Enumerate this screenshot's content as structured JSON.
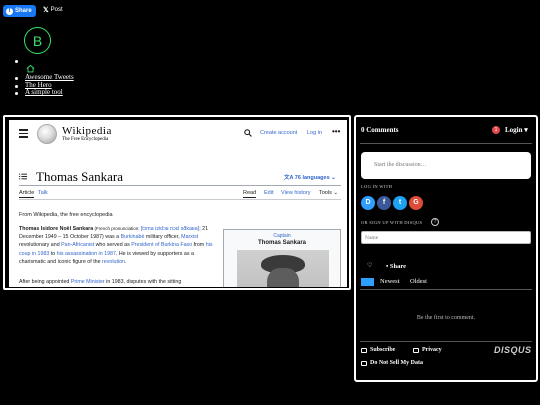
{
  "share_bar": {
    "facebook_label": "Share",
    "x_label": "Post"
  },
  "site": {
    "logo_letter": "B",
    "nav": [
      "Awesome Tweets",
      "The Hero",
      "A simple tool"
    ]
  },
  "wikipedia": {
    "wordmark": "Wikipedia",
    "tagline": "The Free Encyclopedia",
    "create_account": "Create account",
    "log_in": "Log in",
    "more": "•••",
    "article_title": "Thomas Sankara",
    "languages": "76 languages",
    "tabs_left": [
      "Article",
      "Talk"
    ],
    "tabs_right": [
      "Read",
      "Edit",
      "View history",
      "Tools"
    ],
    "from": "From Wikipedia, the free encyclopedia",
    "lead_name": "Thomas Isidore Noël Sankara",
    "lead_pron": " (French pronunciation: ",
    "lead_ipa": "[tɔma izidɔʁ nɔɛl sɑ̃kaʁa]",
    "lead_dates": "; 21 December 1949 – 15 October 1987) was a ",
    "lead_burkinabe": "Burkinabè",
    "lead_mil": " military officer, ",
    "lead_marxist": "Marxist",
    "lead_rev": " revolutionary and ",
    "lead_panafrican": "Pan-Africanist",
    "lead_served": " who served as ",
    "lead_president": "President of Burkina Faso",
    "lead_from": " from ",
    "lead_coup": "his coup in 1983",
    "lead_to": " to ",
    "lead_assass": "his assassination in 1987",
    "lead_viewed": ". He is viewed by supporters as a charismatic and iconic figure of the ",
    "lead_revolution": "revolution",
    "lead_end": ".",
    "para2_a": "After being appointed ",
    "para2_pm": "Prime Minister",
    "para2_b": " in 1983, disputes with the sitting",
    "infobox_caption": "Captain",
    "infobox_name": "Thomas Sankara"
  },
  "disqus": {
    "comment_count": "0 Comments",
    "notification_count": "1",
    "login": "Login ▾",
    "start_placeholder": "Start the discussion…",
    "log_in_with": "LOG IN WITH",
    "social": [
      {
        "letter": "D",
        "color": "#2e9fff"
      },
      {
        "letter": "f",
        "color": "#3b5998"
      },
      {
        "letter": "t",
        "color": "#1da1f2"
      },
      {
        "letter": "G",
        "color": "#dd4b39"
      }
    ],
    "or_sign_up": "OR SIGN UP WITH DISQUS",
    "help": "?",
    "name_placeholder": "Name",
    "heart": "♡",
    "share": "• Share",
    "sort_best": "Best",
    "sort_newest": "Newest",
    "sort_oldest": "Oldest",
    "first_comment": "Be the first to comment.",
    "subscribe": "Subscribe",
    "privacy": "Privacy",
    "brand": "DISQUS",
    "do_not_sell": "Do Not Sell My Data"
  }
}
